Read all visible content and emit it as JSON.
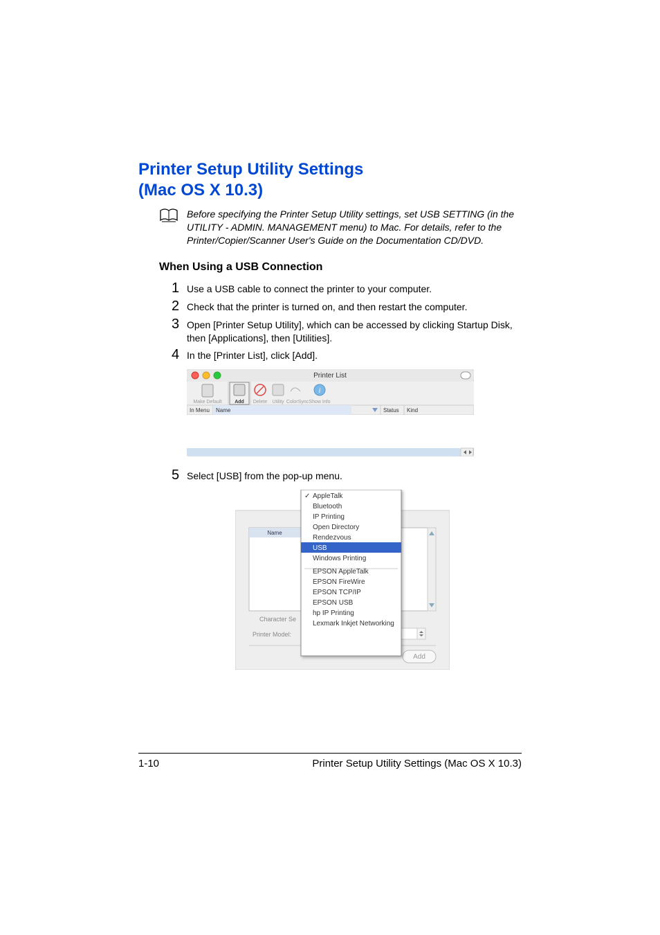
{
  "heading_line1": "Printer Setup Utility Settings",
  "heading_line2": "(Mac OS X 10.3)",
  "note": "Before specifying the Printer Setup Utility settings, set USB SETTING (in the UTILITY - ADMIN. MANAGEMENT menu) to Mac. For details, refer to the Printer/Copier/Scanner User's Guide on the Documentation CD/DVD.",
  "sub_heading": "When Using a USB Connection",
  "steps": {
    "s1": "Use a USB cable to connect the printer to your computer.",
    "s2": "Check that the printer is turned on, and then restart the computer.",
    "s3": "Open [Printer Setup Utility], which can be accessed by clicking Startup Disk, then [Applications], then [Utilities].",
    "s4": "In the [Printer List], click [Add].",
    "s5": "Select [USB] from the pop-up menu."
  },
  "printer_list": {
    "title": "Printer List",
    "toolbar": {
      "make_default": "Make Default",
      "add": "Add",
      "delete": "Delete",
      "utility": "Utility",
      "colorsync": "ColorSync",
      "show_info": "Show Info"
    },
    "columns": {
      "in_menu": "In Menu",
      "name": "Name",
      "status": "Status",
      "kind": "Kind"
    }
  },
  "connection_dialog": {
    "col_name": "Name",
    "character_set": "Character Se",
    "printer_model": "Printer Model:",
    "add_button": "Add",
    "menu_items": [
      "AppleTalk",
      "Bluetooth",
      "IP Printing",
      "Open Directory",
      "Rendezvous",
      "USB",
      "Windows Printing",
      "EPSON AppleTalk",
      "EPSON FireWire",
      "EPSON TCP/IP",
      "EPSON USB",
      "hp IP Printing",
      "Lexmark Inkjet Networking"
    ],
    "selected_index": 5
  },
  "footer": {
    "page": "1-10",
    "title": "Printer Setup Utility Settings (Mac OS X 10.3)"
  }
}
